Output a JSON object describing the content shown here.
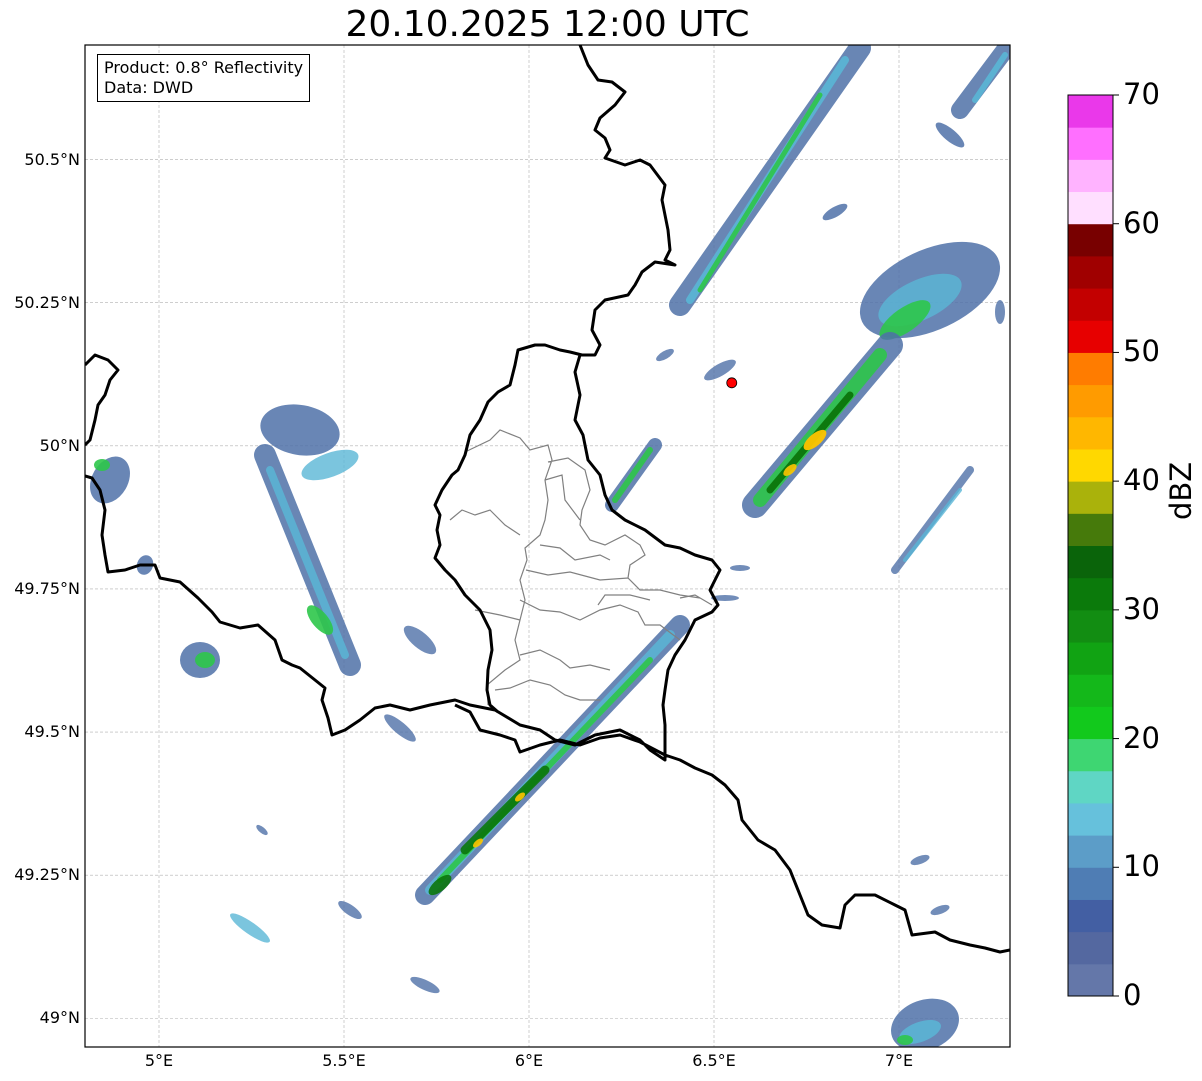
{
  "title": "20.10.2025 12:00 UTC",
  "info": {
    "product": "Product: 0.8° Reflectivity",
    "data": "Data: DWD"
  },
  "map": {
    "extent": {
      "lon_min": 4.8,
      "lon_max": 7.3,
      "lat_min": 48.95,
      "lat_max": 50.7
    },
    "lat_ticks": [
      {
        "value": 50.5,
        "label": "50.5°N"
      },
      {
        "value": 50.25,
        "label": "50.25°N"
      },
      {
        "value": 50.0,
        "label": "50°N"
      },
      {
        "value": 49.75,
        "label": "49.75°N"
      },
      {
        "value": 49.5,
        "label": "49.5°N"
      },
      {
        "value": 49.25,
        "label": "49.25°N"
      },
      {
        "value": 49.0,
        "label": "49°N"
      }
    ],
    "lon_ticks": [
      {
        "value": 5.0,
        "label": "5°E"
      },
      {
        "value": 5.5,
        "label": "5.5°E"
      },
      {
        "value": 6.0,
        "label": "6°E"
      },
      {
        "value": 6.5,
        "label": "6.5°E"
      },
      {
        "value": 7.0,
        "label": "7°E"
      }
    ],
    "radar_site": {
      "lon": 6.548,
      "lat": 50.11,
      "color": "#ff0000"
    }
  },
  "colorbar": {
    "unit": "dBZ",
    "min": 0,
    "max": 70,
    "ticks": [
      {
        "value": 0,
        "label": "0"
      },
      {
        "value": 10,
        "label": "10"
      },
      {
        "value": 20,
        "label": "20"
      },
      {
        "value": 30,
        "label": "30"
      },
      {
        "value": 40,
        "label": "40"
      },
      {
        "value": 50,
        "label": "50"
      },
      {
        "value": 60,
        "label": "60"
      },
      {
        "value": 70,
        "label": "70"
      }
    ],
    "colors": [
      "#6477a9",
      "#5468a0",
      "#435fa3",
      "#4f7db4",
      "#5c9dc8",
      "#66c1dc",
      "#5fd6c4",
      "#3ed672",
      "#12c91c",
      "#14b81a",
      "#11a313",
      "#128d12",
      "#0b7a0b",
      "#0a640a",
      "#467a0b",
      "#aab20b",
      "#ffd800",
      "#ffb700",
      "#ff9b00",
      "#ff7c00",
      "#e70000",
      "#c30000",
      "#a00000",
      "#780000",
      "#ffdfff",
      "#ffb3ff",
      "#ff6fff",
      "#ea38ea"
    ]
  },
  "echo_colors": {
    "weak": "#4f71a8",
    "light": "#5ab6d6",
    "moderate": "#2ec64a",
    "strong": "#0b760b",
    "heavy": "#ffc400"
  }
}
